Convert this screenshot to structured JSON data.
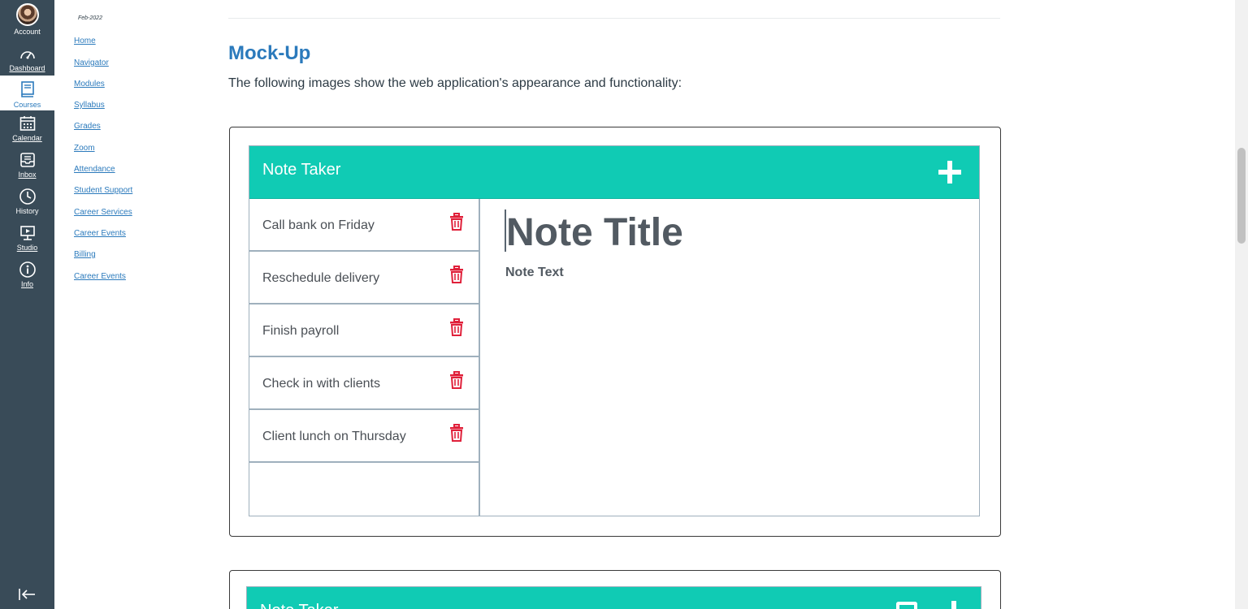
{
  "global_nav": {
    "account": "Account",
    "dashboard": "Dashboard",
    "courses": "Courses",
    "calendar": "Calendar",
    "inbox": "Inbox",
    "history": "History",
    "studio": "Studio",
    "info": "Info",
    "active_color": "#2b7abc",
    "background": "#394b58"
  },
  "course_nav": {
    "term": "Feb-2022",
    "links": [
      "Home",
      "Navigator",
      "Modules",
      "Syllabus",
      "Grades",
      "Zoom",
      "Attendance",
      "Student Support",
      "Career Services",
      "Career Events",
      "Billing",
      "Career Events"
    ]
  },
  "content": {
    "heading": "Mock-Up",
    "intro": "The following images show the web application's appearance and functionality:"
  },
  "mockup1": {
    "app_title": "Note Taker",
    "accent": "#10cbb4",
    "notes": [
      "Call bank on Friday",
      "Reschedule delivery",
      "Finish payroll",
      "Check in with clients",
      "Client lunch on Thursday"
    ],
    "note_title_placeholder": "Note Title",
    "note_text_placeholder": "Note Text",
    "trash_color": "#e0203a"
  },
  "mockup2": {
    "app_title": "Note Taker"
  }
}
